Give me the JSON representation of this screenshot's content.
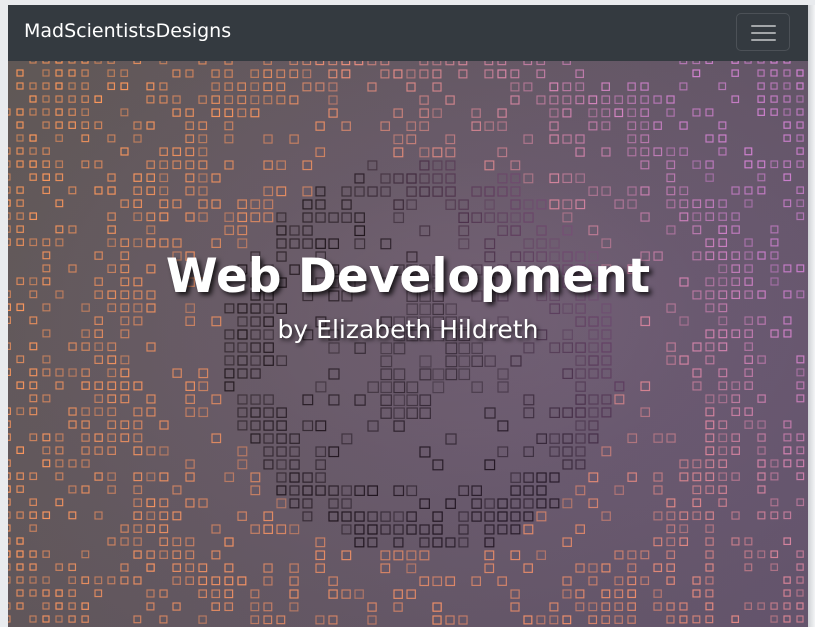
{
  "navbar": {
    "brand": "MadScientistsDesigns",
    "toggler_icon": "hamburger-menu-icon"
  },
  "hero": {
    "title": "Web Development",
    "subtitle": "by Elizabeth Hildreth",
    "background_image": "orange-purple-digital-grid-tunnel",
    "colors": {
      "grid_warm": "#ff9a5c",
      "grid_hot": "#ffc45a",
      "grid_cool": "#d98ad6",
      "background": "#5a575c"
    }
  }
}
